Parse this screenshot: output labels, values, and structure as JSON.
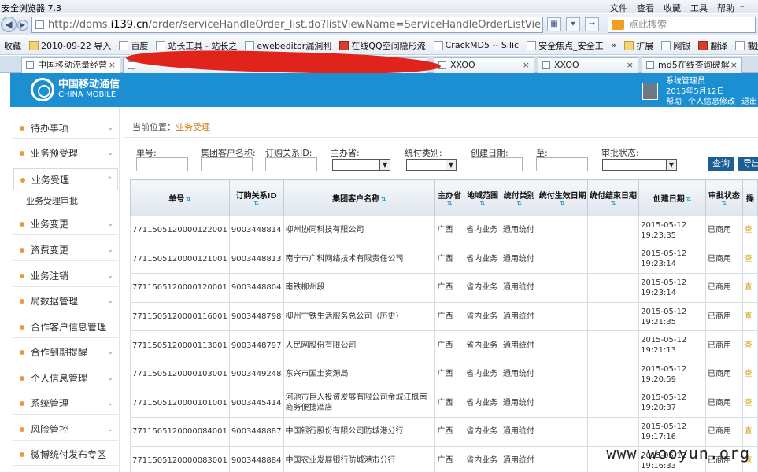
{
  "browser": {
    "title": "安全浏览器 7.3",
    "menus": [
      "文件",
      "查看",
      "收藏",
      "工具",
      "帮助"
    ],
    "url_prefix": "http://doms.",
    "url_domain": "i139.cn",
    "url_rest": "/order/serviceHandleOrder_list.do?listViewName=ServiceHandleOrderListView&&ord",
    "search_placeholder": "点此搜索",
    "favorites": [
      {
        "label": "收藏",
        "icon": "star-icon"
      },
      {
        "label": "2010-09-22 导入",
        "icon": "folder-icon"
      },
      {
        "label": "百度",
        "icon": "baidu-icon"
      },
      {
        "label": "站长工具 - 站长之",
        "icon": "page-icon"
      },
      {
        "label": "ewebeditor漏洞利",
        "icon": "page-icon"
      },
      {
        "label": "在线QQ空间隐形流",
        "icon": "gift-icon"
      },
      {
        "label": "CrackMD5 -- Silic",
        "icon": "page-icon"
      },
      {
        "label": "安全焦点_安全工",
        "icon": "page-icon"
      },
      {
        "label": "扩展",
        "icon": "extension-icon"
      },
      {
        "label": "网银",
        "icon": "bank-icon"
      },
      {
        "label": "翻译",
        "icon": "translate-icon"
      },
      {
        "label": "截图",
        "icon": "screenshot-icon"
      }
    ],
    "tabs": [
      {
        "label": "中国移动流量经营"
      },
      {
        "label": ""
      },
      {
        "label": "XXOO"
      },
      {
        "label": "XXOO"
      },
      {
        "label": "md5在线查询破解"
      }
    ]
  },
  "header": {
    "logo_cn": "中国移动通信",
    "logo_en": "CHINA MOBILE",
    "user_name": "系统管理员",
    "date": "2015年5月12日",
    "links": [
      "帮助",
      "个人信息修改",
      "退出"
    ]
  },
  "sidebar": {
    "items": [
      {
        "label": "待办事项"
      },
      {
        "label": "业务预受理"
      },
      {
        "label": "业务受理",
        "sub": "业务受理审批"
      },
      {
        "label": "业务变更"
      },
      {
        "label": "资费变更"
      },
      {
        "label": "业务注销"
      },
      {
        "label": "局数据管理"
      },
      {
        "label": "合作客户信息管理"
      },
      {
        "label": "合作到期提醒"
      },
      {
        "label": "个人信息管理"
      },
      {
        "label": "系统管理"
      },
      {
        "label": "风险管控"
      },
      {
        "label": "微博统付发布专区"
      }
    ]
  },
  "breadcrumb": {
    "prefix": "当前位置：",
    "current": "业务受理"
  },
  "filters": {
    "labels": [
      "单号:",
      "集团客户名称:",
      "订购关系ID:",
      "主办省:",
      "统付类别:",
      "创建日期:",
      "至:",
      "审批状态:"
    ],
    "query_button": "查询",
    "export_button": "导出"
  },
  "table": {
    "columns": [
      "单号",
      "订购关系ID",
      "集团客户名称",
      "主办省",
      "地域范围",
      "统付类别",
      "统付生效日期",
      "统付结束日期",
      "创建日期",
      "审批状态",
      "操"
    ],
    "rows": [
      [
        "7711505120000122001",
        "9003448814",
        "柳州协同科技有限公司",
        "广西",
        "省内业务",
        "通用统付",
        "",
        "",
        "2015-05-12 19:23:35",
        "已商用"
      ],
      [
        "7711505120000121001",
        "9003448813",
        "南宁市广科网络技术有限责任公司",
        "广西",
        "省内业务",
        "通用统付",
        "",
        "",
        "2015-05-12 19:23:14",
        "已商用"
      ],
      [
        "7711505120000120001",
        "9003448804",
        "南铁柳州段",
        "广西",
        "省内业务",
        "通用统付",
        "",
        "",
        "2015-05-12 19:23:14",
        "已商用"
      ],
      [
        "7711505120000116001",
        "9003448798",
        "柳州宁铁生活服务总公司（历史）",
        "广西",
        "省内业务",
        "通用统付",
        "",
        "",
        "2015-05-12 19:21:35",
        "已商用"
      ],
      [
        "7711505120000113001",
        "9003448797",
        "人民网股份有限公司",
        "广西",
        "省内业务",
        "通用统付",
        "",
        "",
        "2015-05-12 19:21:13",
        "已商用"
      ],
      [
        "7711505120000103001",
        "9003449248",
        "东兴市国土资源局",
        "广西",
        "省内业务",
        "通用统付",
        "",
        "",
        "2015-05-12 19:20:59",
        "已商用"
      ],
      [
        "7711505120000101001",
        "9003445414",
        "河池市巨人投资发展有限公司金城江枫南商务便捷酒店",
        "广西",
        "省内业务",
        "通用统付",
        "",
        "",
        "2015-05-12 19:20:37",
        "已商用"
      ],
      [
        "7711505120000084001",
        "9003448887",
        "中国银行股份有限公司防城港分行",
        "广西",
        "省内业务",
        "通用统付",
        "",
        "",
        "2015-05-12 19:17:16",
        "已商用"
      ],
      [
        "7711505120000083001",
        "9003448884",
        "中国农业发展银行防城港市分行",
        "广西",
        "省内业务",
        "通用统付",
        "",
        "",
        "2015-05-12 19:16:33",
        "已商用"
      ]
    ],
    "action_glyph": "查"
  },
  "watermark": "www.wooyun.org"
}
